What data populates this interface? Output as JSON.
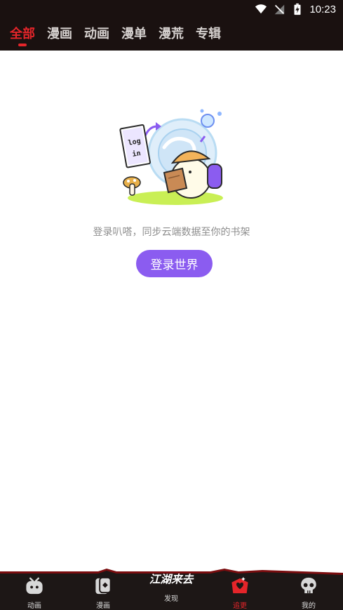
{
  "status_bar": {
    "time": "10:23",
    "icons": [
      "wifi-icon",
      "signal-off-icon",
      "battery-charging-icon"
    ]
  },
  "tabs": [
    {
      "label": "全部",
      "active": true
    },
    {
      "label": "漫画",
      "active": false
    },
    {
      "label": "动画",
      "active": false
    },
    {
      "label": "漫单",
      "active": false
    },
    {
      "label": "漫荒",
      "active": false
    },
    {
      "label": "专辑",
      "active": false
    }
  ],
  "empty_state": {
    "illustration_sign_line1": "log",
    "illustration_sign_line2": "in",
    "message": "登录叭嗒，同步云端数据至你的书架",
    "button_label": "登录世界"
  },
  "bottom_nav": {
    "items": [
      {
        "label": "动画",
        "icon": "tv-icon",
        "active": false
      },
      {
        "label": "漫画",
        "icon": "card-icon",
        "active": false
      },
      {
        "label": "发现",
        "icon": "logo-discover",
        "active": false
      },
      {
        "label": "追更",
        "icon": "heart-box-icon",
        "active": true
      },
      {
        "label": "我的",
        "icon": "skull-icon",
        "active": false
      }
    ],
    "logo_text": "江湖来去"
  },
  "colors": {
    "accent_red": "#e5252a",
    "button_purple": "#8b5cf0",
    "top_bg": "#1a1110",
    "nav_bg": "#1d1716"
  }
}
